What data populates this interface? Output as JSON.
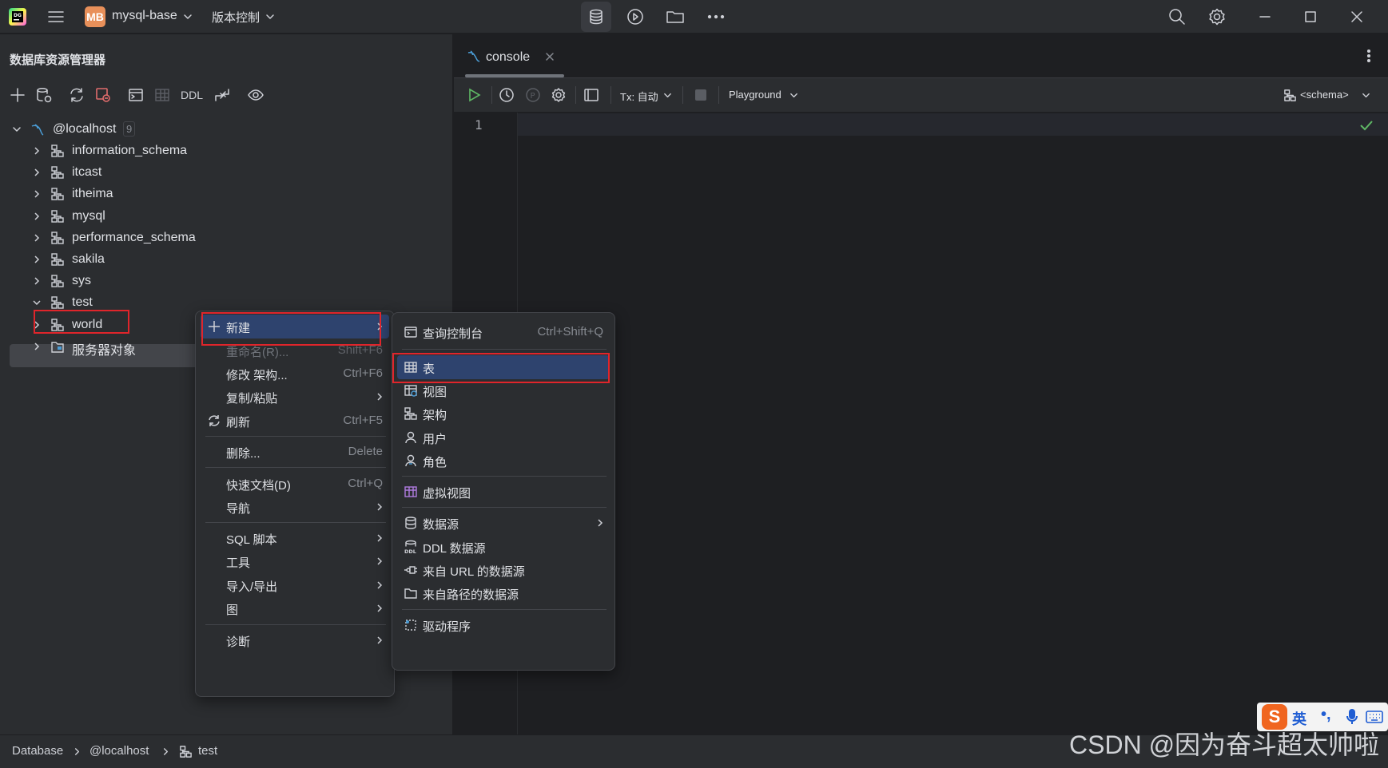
{
  "titlebar": {
    "project_badge": "MB",
    "project_name": "mysql-base",
    "vcs_label": "版本控制"
  },
  "left_panel": {
    "title": "数据库资源管理器",
    "toolbar_ddl": "DDL",
    "tree": {
      "root_label": "@localhost",
      "root_count": "9",
      "items": [
        {
          "label": "information_schema"
        },
        {
          "label": "itcast"
        },
        {
          "label": "itheima"
        },
        {
          "label": "mysql"
        },
        {
          "label": "performance_schema"
        },
        {
          "label": "sakila"
        },
        {
          "label": "sys"
        },
        {
          "label": "test"
        },
        {
          "label": "world"
        },
        {
          "label": "服务器对象"
        }
      ]
    }
  },
  "editor": {
    "tab_label": "console",
    "tx_label": "Tx: 自动",
    "playground_label": "Playground",
    "schema_label": "<schema>",
    "line_number": "1"
  },
  "context_menu": {
    "items": [
      {
        "label": "新建"
      },
      {
        "label": "重命名(R)...",
        "shortcut": "Shift+F6"
      },
      {
        "label": "修改 架构...",
        "shortcut": "Ctrl+F6"
      },
      {
        "label": "复制/粘贴"
      },
      {
        "label": "刷新",
        "shortcut": "Ctrl+F5"
      },
      {
        "label": "删除...",
        "shortcut": "Delete"
      },
      {
        "label": "快速文档(D)",
        "shortcut": "Ctrl+Q"
      },
      {
        "label": "导航"
      },
      {
        "label": "SQL 脚本"
      },
      {
        "label": "工具"
      },
      {
        "label": "导入/导出"
      },
      {
        "label": "图"
      },
      {
        "label": "诊断"
      }
    ]
  },
  "new_submenu": {
    "items": [
      {
        "label": "查询控制台",
        "shortcut": "Ctrl+Shift+Q"
      },
      {
        "label": "表"
      },
      {
        "label": "视图"
      },
      {
        "label": "架构"
      },
      {
        "label": "用户"
      },
      {
        "label": "角色"
      },
      {
        "label": "虚拟视图"
      },
      {
        "label": "数据源"
      },
      {
        "label": "DDL 数据源"
      },
      {
        "label": "来自 URL 的数据源"
      },
      {
        "label": "来自路径的数据源"
      },
      {
        "label": "驱动程序"
      }
    ]
  },
  "statusbar": {
    "crumbs": [
      "Database",
      "@localhost",
      "test"
    ],
    "watermark": "CSDN @因为奋斗超太帅啦"
  },
  "ime": {
    "logo": "S",
    "lang": "英",
    "punct": "•,"
  },
  "colors": {
    "background": "#1e1f22",
    "panel": "#2b2d30",
    "selection": "#2e436e",
    "highlight_box": "#e0252b",
    "project_badge": "#e8905a",
    "run_green": "#5fb865"
  }
}
